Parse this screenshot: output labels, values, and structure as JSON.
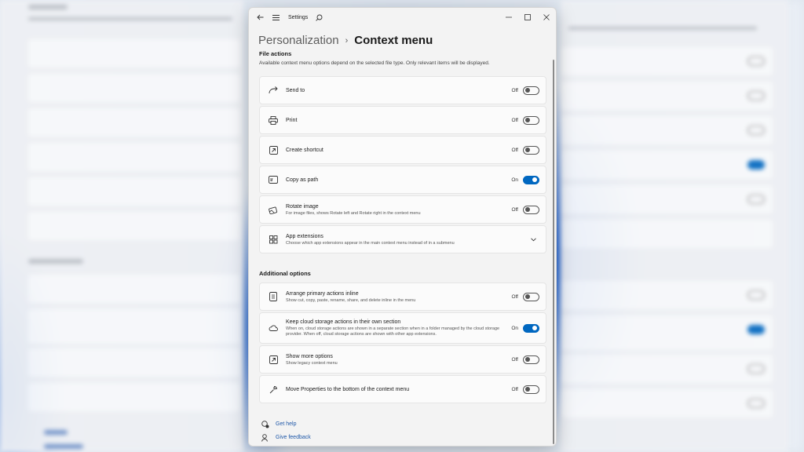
{
  "window": {
    "title": "Settings",
    "breadcrumb_parent": "Personalization",
    "breadcrumb_separator": "›",
    "breadcrumb_current": "Context menu"
  },
  "file_actions": {
    "title": "File actions",
    "description": "Available context menu options depend on the selected file type. Only relevant items will be displayed.",
    "items": [
      {
        "label": "Send to",
        "state": "Off",
        "icon": "share-arrow-icon"
      },
      {
        "label": "Print",
        "state": "Off",
        "icon": "printer-icon"
      },
      {
        "label": "Create shortcut",
        "state": "Off",
        "icon": "shortcut-icon"
      },
      {
        "label": "Copy as path",
        "state": "On",
        "icon": "copy-path-icon"
      },
      {
        "label": "Rotate image",
        "sub": "For image files, shows Rotate left and Rotate right in the context menu",
        "state": "Off",
        "icon": "rotate-image-icon"
      },
      {
        "label": "App extensions",
        "sub": "Choose which app extensions appear in the main context menu instead of in a submenu",
        "icon": "apps-grid-icon"
      }
    ]
  },
  "additional_options": {
    "title": "Additional options",
    "items": [
      {
        "label": "Arrange primary actions inline",
        "sub": "Show cut, copy, paste, rename, share, and delete inline in the menu",
        "state": "Off",
        "icon": "arrange-icon"
      },
      {
        "label": "Keep cloud storage actions in their own section",
        "sub": "When on, cloud storage actions are shown in a separate section when in a folder managed by the cloud storage provider. When off, cloud storage actions are shown with other app extensions.",
        "state": "On",
        "icon": "cloud-icon"
      },
      {
        "label": "Show more options",
        "sub": "Show legacy context menu",
        "state": "Off",
        "icon": "more-options-icon"
      },
      {
        "label": "Move Properties to the bottom of the context menu",
        "state": "Off",
        "icon": "wrench-icon"
      }
    ]
  },
  "links": {
    "help": "Get help",
    "feedback": "Give feedback"
  },
  "colors": {
    "accent": "#0067c0",
    "link": "#1f58a8"
  }
}
